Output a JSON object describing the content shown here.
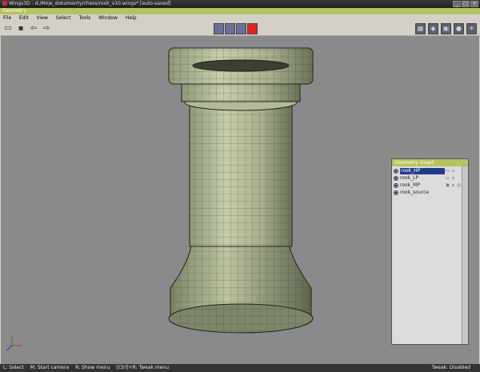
{
  "window": {
    "title": "Wings3D - d:/Moje_dokumenty/chess/rook_v10.wings* [auto-saved]",
    "controls": [
      "_",
      "□",
      "×"
    ]
  },
  "header": {
    "geometry_label": "Geometry"
  },
  "menu": {
    "items": [
      "File",
      "Edit",
      "View",
      "Select",
      "Tools",
      "Window",
      "Help"
    ]
  },
  "toolbar": {
    "left_icons": [
      "open-icon",
      "save-icon",
      "undo-icon",
      "redo-icon"
    ],
    "selection_modes": [
      "vertex-mode",
      "edge-mode",
      "face-mode",
      "body-mode"
    ],
    "active_mode": "body-mode",
    "right_icons": [
      "groundplane-icon",
      "axes-icon",
      "perspective-icon",
      "smooth-icon",
      "light-icon"
    ],
    "active_color": "#d22222"
  },
  "geometry_graph": {
    "title": "Geometry Graph",
    "objects": [
      {
        "name": "rook_HP",
        "selected": true
      },
      {
        "name": "rook_LP",
        "selected": false
      },
      {
        "name": "rook_MP",
        "selected": false
      },
      {
        "name": "rook_source",
        "selected": false
      }
    ]
  },
  "status": {
    "hints": [
      "L: Select",
      "M: Start camera",
      "R: Show menu",
      "[Ctrl]+R: Tweak menu"
    ],
    "tweak": "Tweak: Disabled"
  }
}
